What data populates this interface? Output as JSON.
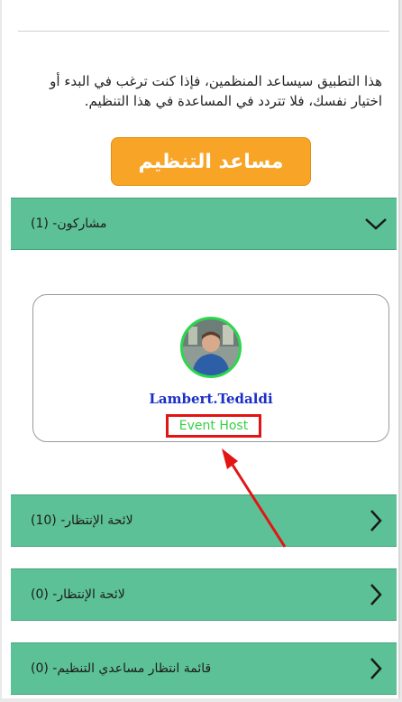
{
  "intro_text": "هذا التطبيق سيساعد المنظمين، فإذا كنت ترغب في البدء أو اختيار نفسك، فلا تتردد في المساعدة في هذا التنظيم.",
  "organizer_button_label": "مساعد التنظيم",
  "sections": [
    {
      "label": "مشاركون- (1)",
      "expanded": true
    },
    {
      "label": "لائحة الإنتظار- (10)",
      "expanded": false
    },
    {
      "label": "لائحة الإنتظار- (0)",
      "expanded": false
    },
    {
      "label": "قائمة انتظار مساعدي التنظيم- (0)",
      "expanded": false
    }
  ],
  "participant": {
    "name": "Lambert.Tedaldi",
    "role": "Event Host"
  },
  "colors": {
    "accordion_bg": "#5cc196",
    "button_bg": "#f8a527",
    "highlight": "#e31414",
    "role_text": "#35d145",
    "name_text": "#1a2fc5"
  },
  "icons": {
    "expanded": "chevron-down-icon",
    "collapsed": "chevron-right-icon"
  }
}
